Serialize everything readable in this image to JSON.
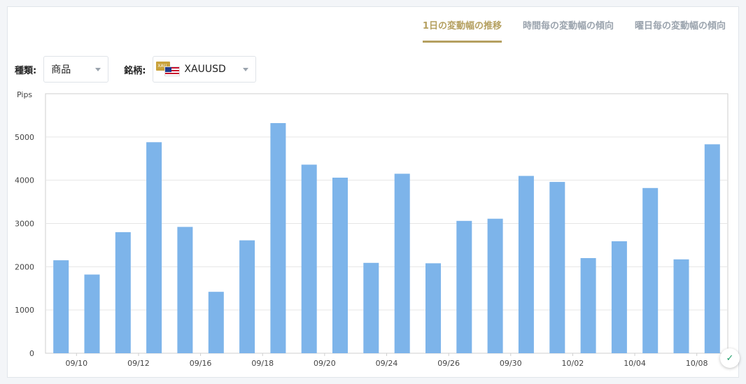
{
  "tabs": [
    {
      "label": "1日の変動幅の推移",
      "active": true
    },
    {
      "label": "時間毎の変動幅の傾向",
      "active": false
    },
    {
      "label": "曜日毎の変動幅の傾向",
      "active": false
    }
  ],
  "filters": {
    "kind_label": "種類:",
    "kind_value": "商品",
    "symbol_label": "銘柄:",
    "symbol_value": "XAUUSD",
    "symbol_flag_badge": "XAU"
  },
  "colors": {
    "bar": "#7db4ea",
    "accent": "#b5a060",
    "grid": "#e6e6e6"
  },
  "chart_data": {
    "type": "bar",
    "ylabel": "Pips",
    "ylim": [
      0,
      6000
    ],
    "yticks": [
      0,
      1000,
      2000,
      3000,
      4000,
      5000
    ],
    "x_tick_labels": [
      "09/10",
      "09/12",
      "09/16",
      "09/18",
      "09/20",
      "09/24",
      "09/26",
      "09/30",
      "10/02",
      "10/04",
      "10/08"
    ],
    "values": [
      2150,
      1820,
      2800,
      4880,
      2920,
      1420,
      2610,
      5320,
      4360,
      4060,
      2090,
      4150,
      2080,
      3060,
      3110,
      4100,
      3960,
      2200,
      2590,
      3820,
      2170,
      4830
    ],
    "grid": true,
    "legend": "none"
  },
  "badge": {
    "icon": "tradingview-icon",
    "glyph": "✓"
  }
}
